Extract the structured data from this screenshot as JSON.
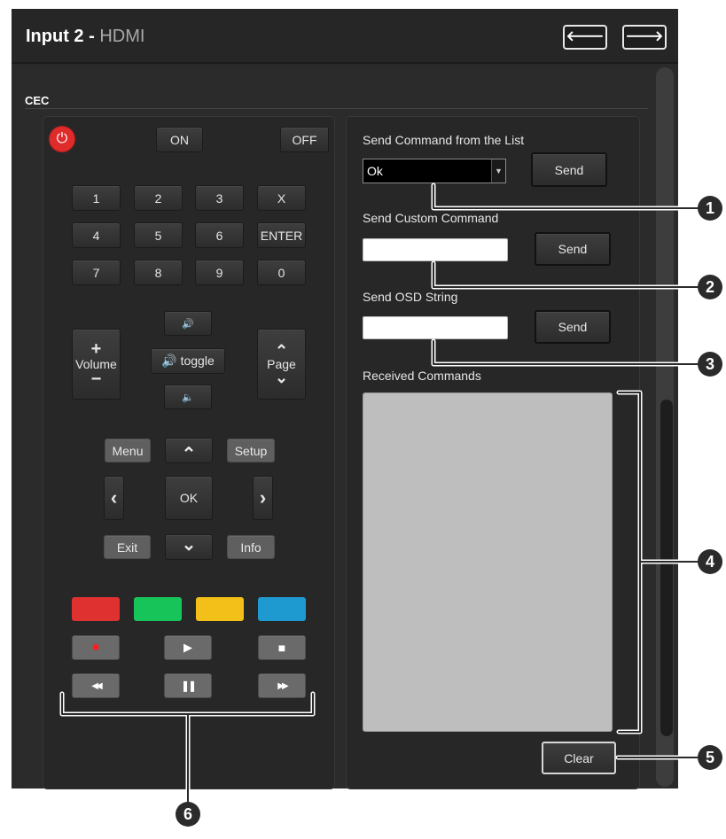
{
  "window": {
    "title": "Input 2",
    "title_separator": " - ",
    "subtitle": "HDMI",
    "back_arrow": "🡐",
    "forward_arrow": "🡒"
  },
  "section": {
    "label": "CEC"
  },
  "remote": {
    "power_icon": "power-icon",
    "on_label": "ON",
    "off_label": "OFF",
    "keypad": [
      "1",
      "2",
      "3",
      "X",
      "4",
      "5",
      "6",
      "ENTER",
      "7",
      "8",
      "9",
      "0"
    ],
    "volume_plus": "+",
    "volume_label": "Volume",
    "volume_minus": "−",
    "vol_up_glyph": "🔊",
    "mute_toggle_label": "🔊 toggle",
    "vol_down_glyph": "🔈",
    "page_up": "⌃",
    "page_label": "Page",
    "page_down": "⌄",
    "menu_label": "Menu",
    "setup_label": "Setup",
    "exit_label": "Exit",
    "info_label": "Info",
    "ok_label": "OK",
    "up_glyph": "⌃",
    "down_glyph": "⌄",
    "left_glyph": "‹",
    "right_glyph": "›",
    "record_glyph": "●",
    "play_glyph": "▶",
    "stop_glyph": "■",
    "rewind_glyph": "◀◀",
    "pause_glyph": "❚❚",
    "forward_glyph": "▶▶",
    "color_keys": [
      "#e03131",
      "#17c45a",
      "#f2c019",
      "#1f9ad1"
    ]
  },
  "commands": {
    "list_label": "Send Command from the List",
    "list_selected": "Ok",
    "send_label": "Send",
    "custom_label": "Send Custom Command",
    "custom_value": "",
    "osd_label": "Send OSD String",
    "osd_value": "",
    "received_label": "Received Commands",
    "clear_label": "Clear"
  },
  "callouts": [
    "1",
    "2",
    "3",
    "4",
    "5",
    "6"
  ]
}
